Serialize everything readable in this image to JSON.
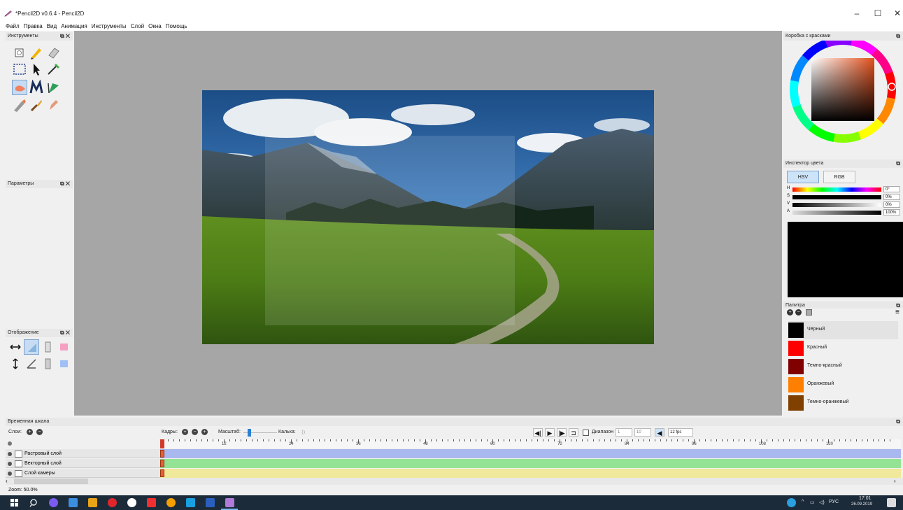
{
  "window": {
    "title": "*Pencil2D v0.6.4 - Pencil2D",
    "controls": [
      "–",
      "☐",
      "✕"
    ]
  },
  "menu": [
    "Файл",
    "Правка",
    "Вид",
    "Анимация",
    "Инструменты",
    "Слой",
    "Окна",
    "Помощь"
  ],
  "panels": {
    "tools": {
      "title": "Инструменты"
    },
    "options": {
      "title": "Параметры"
    },
    "display": {
      "title": "Отображение"
    },
    "colorbox": {
      "title": "Коробка с красками"
    },
    "inspector": {
      "title": "Инспектор цвета",
      "tabs": [
        "HSV",
        "RGB"
      ],
      "active_tab": "HSV",
      "sliders": [
        {
          "label": "H",
          "value": "0°"
        },
        {
          "label": "S",
          "value": "0%"
        },
        {
          "label": "V",
          "value": "0%"
        },
        {
          "label": "A",
          "value": "100%"
        }
      ],
      "preview_color": "#000000"
    },
    "palette": {
      "title": "Палитра",
      "colors": [
        {
          "name": "Чёрный",
          "hex": "#000000"
        },
        {
          "name": "Красный",
          "hex": "#ff0000"
        },
        {
          "name": "Темно-красный",
          "hex": "#800000"
        },
        {
          "name": "Оранжевый",
          "hex": "#ff8000"
        },
        {
          "name": "Темно-оранжевый",
          "hex": "#804000"
        }
      ]
    }
  },
  "timeline": {
    "title": "Временная шкала",
    "layers_label": "Слои:",
    "frames_label": "Кадры:",
    "scale_label": "Масштаб:",
    "onion_label": "Калька:",
    "range_label": "Диапазон",
    "range_start": "1",
    "range_end": "10",
    "fps": "12 fps",
    "ruler_labels": [
      "12",
      "24",
      "36",
      "48",
      "60",
      "72",
      "84",
      "96",
      "108",
      "120"
    ],
    "layers": [
      {
        "name": "Растровый слой",
        "track_color": "#a9b8ee"
      },
      {
        "name": "Векторный слой",
        "track_color": "#94e394"
      },
      {
        "name": "Слой камеры",
        "track_color": "#f0e89a"
      }
    ],
    "zoom": "Zoom: 50.0%"
  },
  "taskbar": {
    "lang": "РУС",
    "time": "17:01",
    "date": "26.09.2019"
  }
}
